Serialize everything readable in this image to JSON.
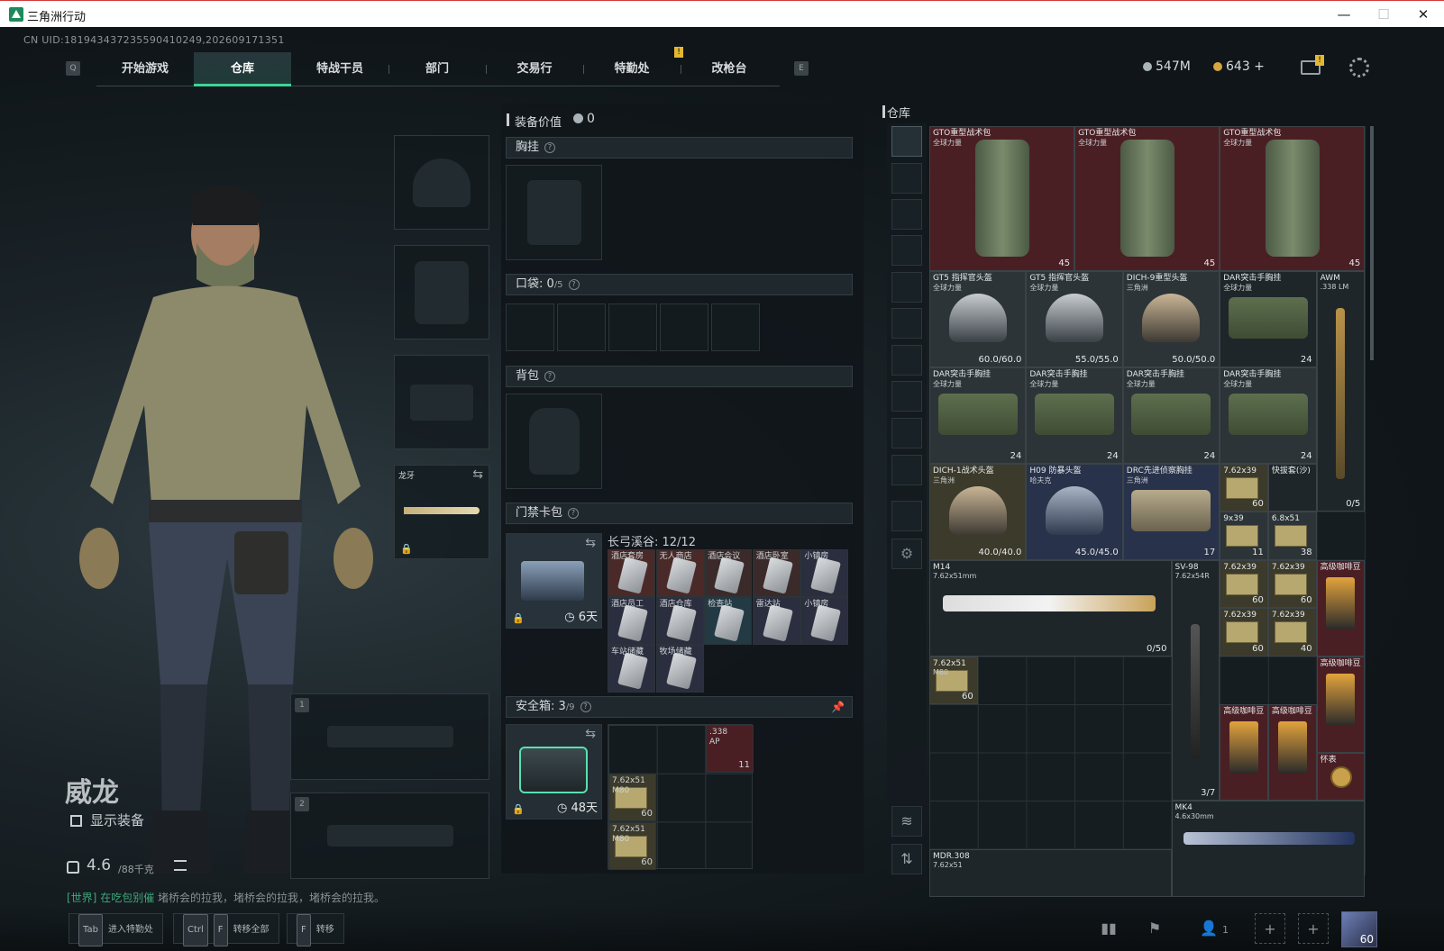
{
  "window": {
    "title": "三角洲行动",
    "min": "—",
    "max": "☐",
    "close": "✕"
  },
  "uid": "CN UID:1819434372355904102​49,202609171351",
  "nav": {
    "key_left": "Q",
    "key_right": "E",
    "notice": "!",
    "tabs": [
      "开始游戏",
      "仓库",
      "特战干员",
      "部门",
      "交易行",
      "特勤处",
      "改枪台"
    ],
    "active": 1
  },
  "currency": {
    "silver": "547M",
    "gold": "643 +",
    "mail_badge": "!"
  },
  "character": {
    "name": "威龙",
    "show_equipment": "显示装备",
    "weight": "4.6",
    "weight_unit": "/88千克"
  },
  "chat": {
    "channel": "[世界]",
    "speaker": "在吃包别催",
    "message": "堵桥会的拉我，堵桥会的拉我，堵桥会的拉我。"
  },
  "equip": {
    "melee_label": "龙牙",
    "slot1": "1",
    "slot2": "2"
  },
  "loadout": {
    "value_label": "装备价值",
    "value": "0",
    "chest_rig": "胸挂",
    "pockets": "口袋:",
    "pockets_used": "0",
    "pockets_total": "/5",
    "backpack": "背包",
    "keycard": "门禁卡包",
    "keycard_timer": "6天",
    "keycard_map": "长弓溪谷: 12/12",
    "keycards": [
      {
        "name": "酒店套房",
        "tint": "#4a2a28"
      },
      {
        "name": "无人商店",
        "tint": "#4a2a28"
      },
      {
        "name": "酒店会议",
        "tint": "#3b2a2a"
      },
      {
        "name": "酒店卧室",
        "tint": "#3b2a2a"
      },
      {
        "name": "小镇房",
        "tint": "#2b2e3f"
      },
      {
        "name": "酒店员工",
        "tint": "#2b2e3f"
      },
      {
        "name": "酒店仓库",
        "tint": "#2b2e3f"
      },
      {
        "name": "检查站",
        "tint": "#233a44"
      },
      {
        "name": "雷达站",
        "tint": "#2b2e3f"
      },
      {
        "name": "小镇房",
        "tint": "#2b2e3f"
      },
      {
        "name": "车站储藏",
        "tint": "#2b2e3f"
      },
      {
        "name": "牧场储藏",
        "tint": "#2b2e3f"
      }
    ],
    "safebox": "安全箱:",
    "safebox_used": "3",
    "safebox_total": "/9",
    "safebox_timer": "48天",
    "safebox_items": [
      {
        "name": ".338",
        "sub": "AP",
        "count": "11"
      },
      {
        "name": "7.62x51",
        "sub": "M80",
        "count": "60"
      },
      {
        "name": "7.62x51",
        "sub": "M80",
        "count": "60"
      }
    ]
  },
  "warehouse": {
    "title": "仓库",
    "items": [
      {
        "name": "GTO重型战术包",
        "sub": "全球力量",
        "count": "45"
      },
      {
        "name": "GTO重型战术包",
        "sub": "全球力量",
        "count": "45"
      },
      {
        "name": "GTO重型战术包",
        "sub": "全球力量",
        "count": "45"
      },
      {
        "name": "GT5 指挥官头盔",
        "sub": "全球力量",
        "count": "60.0/60.0"
      },
      {
        "name": "GT5 指挥官头盔",
        "sub": "全球力量",
        "count": "55.0/55.0"
      },
      {
        "name": "DICH-9重型头盔",
        "sub": "三角洲",
        "count": "50.0/50.0"
      },
      {
        "name": "DAR突击手胸挂",
        "sub": "全球力量",
        "count": "24"
      },
      {
        "name": "AWM",
        "sub": ".338 LM",
        "count": "0/5"
      },
      {
        "name": "DAR突击手胸挂",
        "sub": "全球力量",
        "count": "24"
      },
      {
        "name": "DAR突击手胸挂",
        "sub": "全球力量",
        "count": "24"
      },
      {
        "name": "DAR突击手胸挂",
        "sub": "全球力量",
        "count": "24"
      },
      {
        "name": "DAR突击手胸挂",
        "sub": "全球力量",
        "count": "24"
      },
      {
        "name": "DICH-1战术头盔",
        "sub": "三角洲",
        "count": "40.0/40.0"
      },
      {
        "name": "H09 防暴头盔",
        "sub": "哈夫克",
        "count": "45.0/45.0"
      },
      {
        "name": "DRC先进侦察胸挂",
        "sub": "三角洲",
        "count": "17"
      },
      {
        "name": "7.62x39",
        "sub": "",
        "count": "60"
      },
      {
        "name": "快拔套(沙)",
        "sub": "",
        "count": ""
      },
      {
        "name": "9x39",
        "sub": "",
        "count": "11"
      },
      {
        "name": "6.8x51",
        "sub": "",
        "count": "38"
      },
      {
        "name": "M14",
        "sub": "7.62x51mm",
        "count": "0/50"
      },
      {
        "name": "SV-98",
        "sub": "7.62x54R",
        "count": "3/7"
      },
      {
        "name": "7.62x39",
        "sub": "",
        "count": "60"
      },
      {
        "name": "7.62x39",
        "sub": "",
        "count": "60"
      },
      {
        "name": "高级咖啡豆",
        "sub": "",
        "count": ""
      },
      {
        "name": "7.62x39",
        "sub": "",
        "count": "60"
      },
      {
        "name": "7.62x39",
        "sub": "",
        "count": "40"
      },
      {
        "name": "7.62x51",
        "sub": "M80",
        "count": "60"
      },
      {
        "name": "高级咖啡豆",
        "sub": "",
        "count": ""
      },
      {
        "name": "高级咖啡豆",
        "sub": "",
        "count": ""
      },
      {
        "name": "高级咖啡豆",
        "sub": "",
        "count": ""
      },
      {
        "name": "怀表",
        "sub": "",
        "count": ""
      },
      {
        "name": "MK4",
        "sub": "4.6x30mm",
        "count": ""
      },
      {
        "name": "MDR.308",
        "sub": "7.62x51",
        "count": ""
      }
    ]
  },
  "bottom": {
    "tab_key": "Tab",
    "tab_label": "进入特勤处",
    "ctrl_key": "Ctrl",
    "f_key": "F",
    "transfer_all": "转移全部",
    "f_key2": "F",
    "transfer": "转移",
    "team_count": "1",
    "avatar_level": "60"
  },
  "colors": {
    "accent": "#3ed59a",
    "warning": "#e2b833",
    "rarity_red": "#4a1f24",
    "rarity_gold": "#3b3a2b",
    "rarity_blue": "#28324a"
  }
}
